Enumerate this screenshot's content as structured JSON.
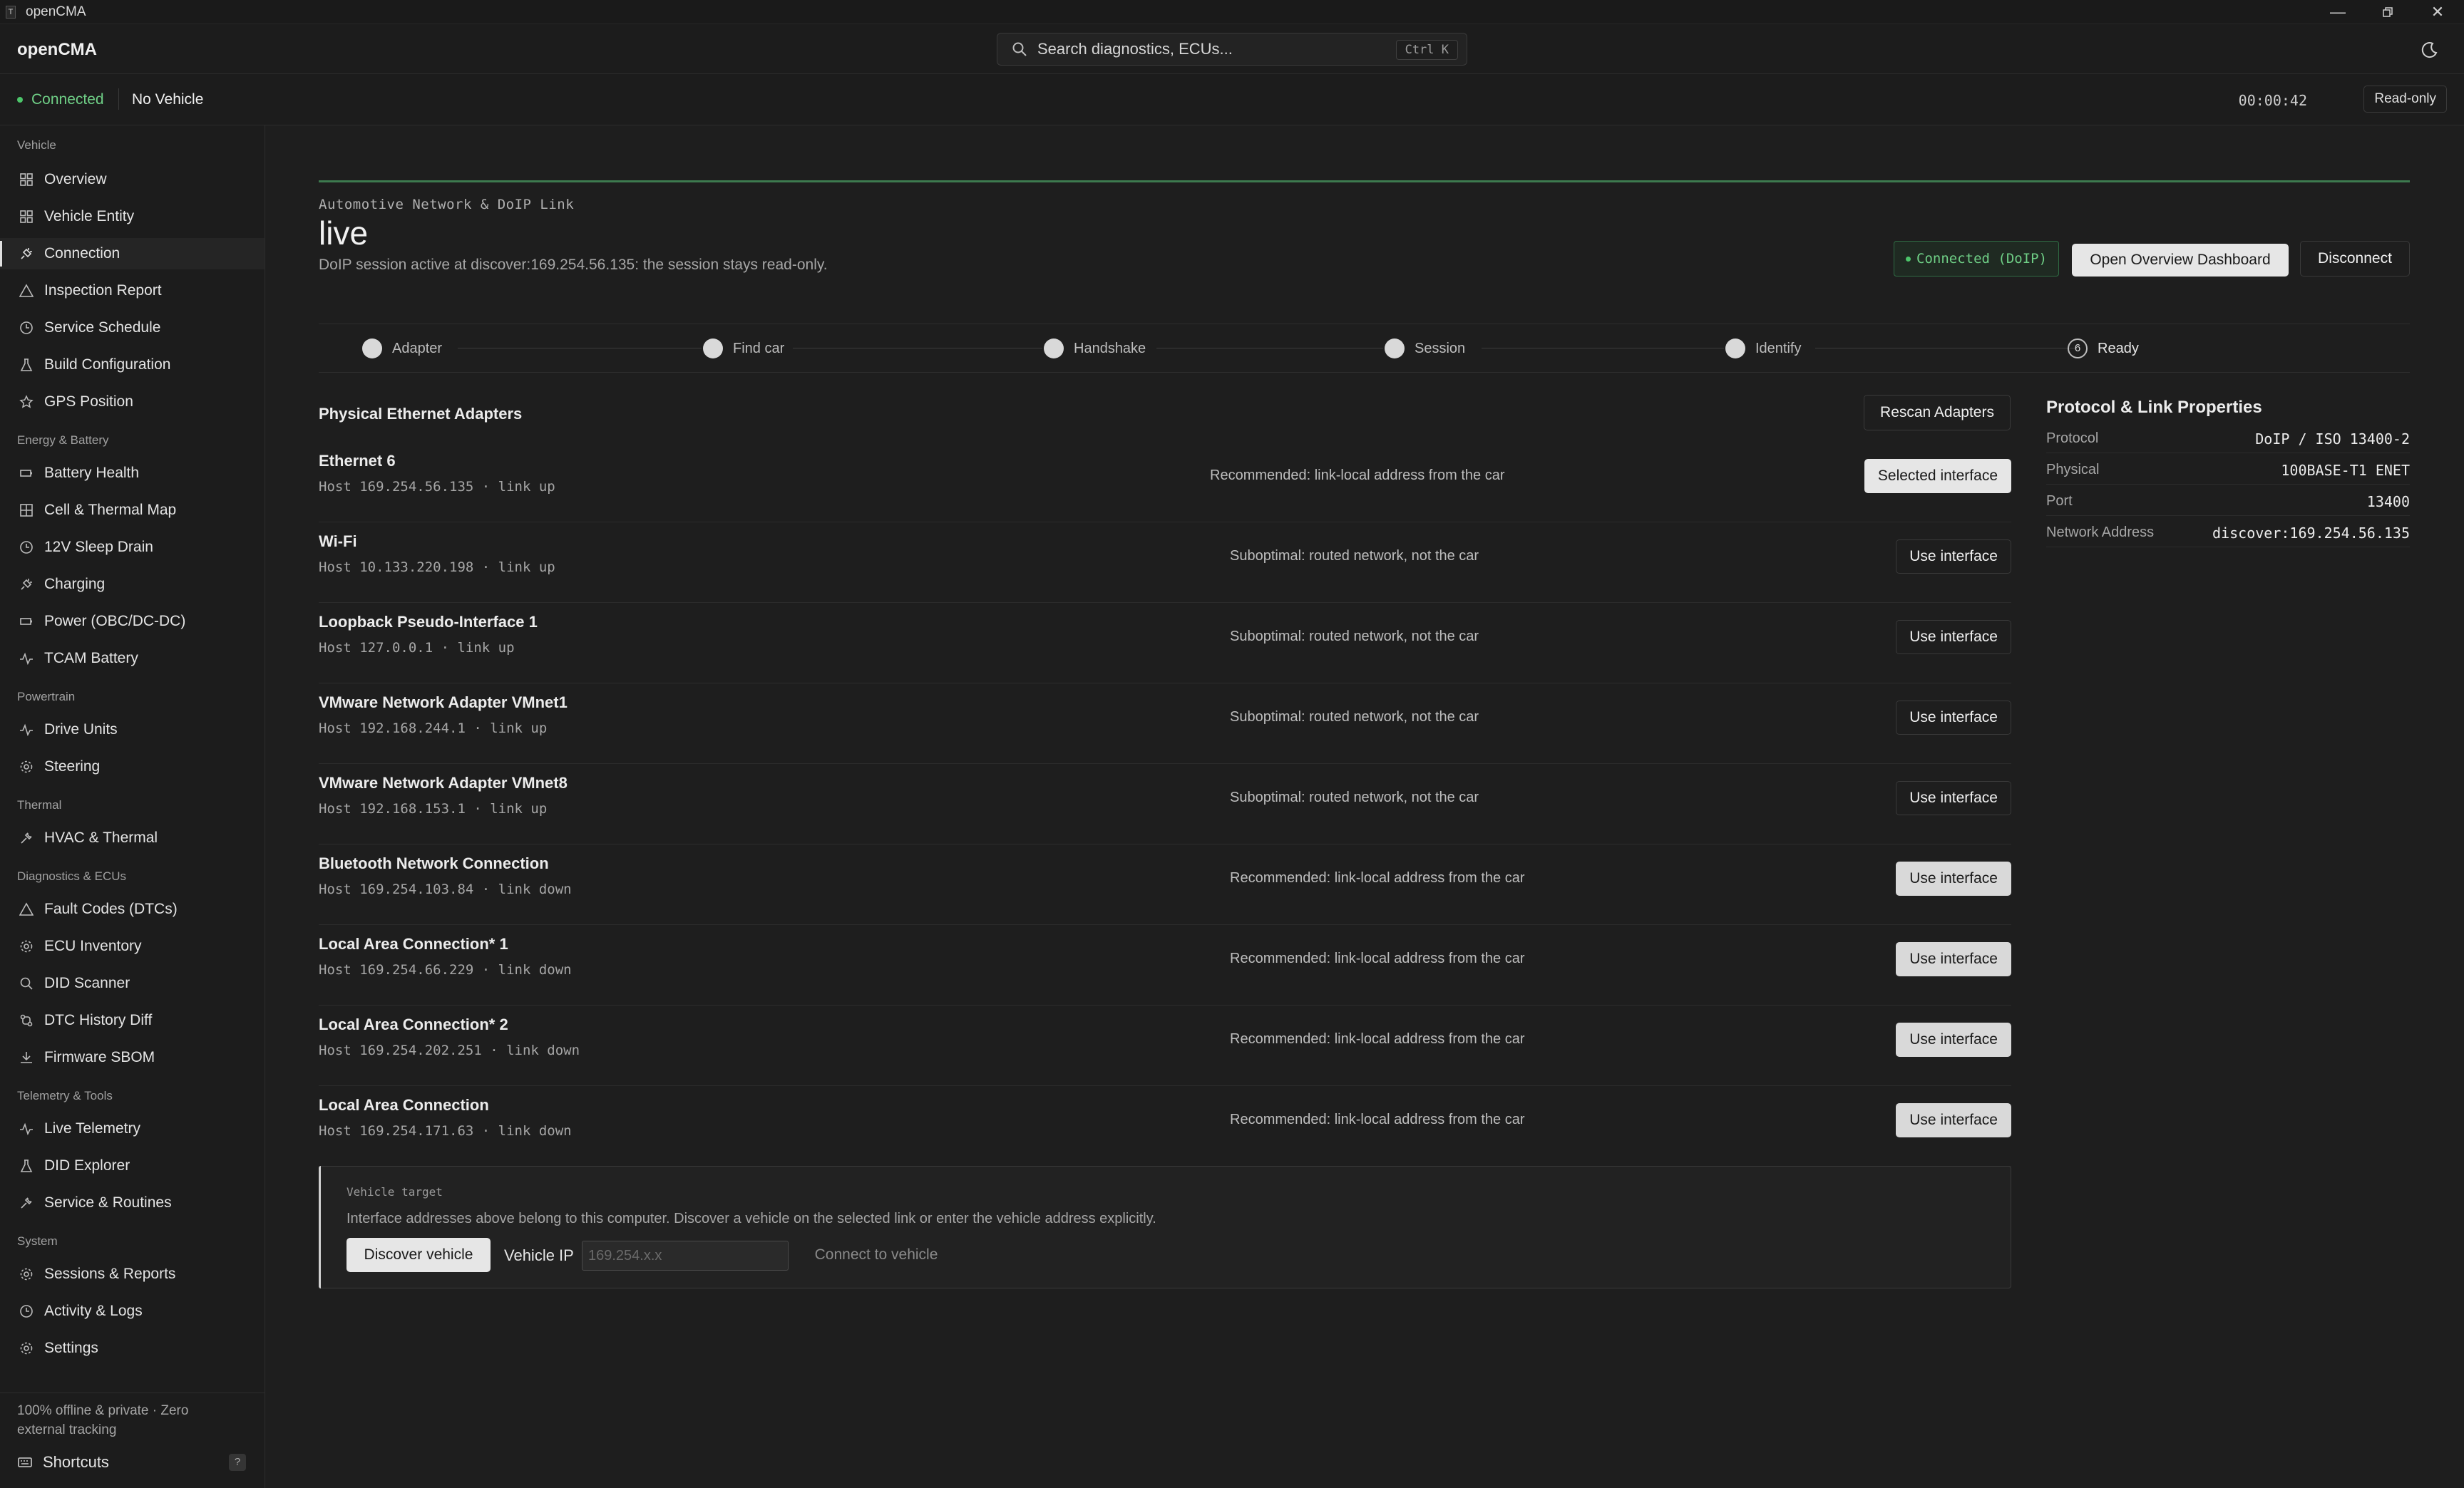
{
  "window": {
    "title": "openCMA",
    "icon_letter": "T"
  },
  "header": {
    "brand": "openCMA",
    "search_placeholder": "Search diagnostics, ECUs...",
    "search_shortcut": "Ctrl K"
  },
  "status": {
    "connection": "Connected",
    "vehicle": "No Vehicle",
    "timer": "00:00:42",
    "mode": "Read-only"
  },
  "sidebar": {
    "sections": [
      {
        "title": "Vehicle",
        "items": [
          {
            "label": "Overview",
            "icon": "grid-icon"
          },
          {
            "label": "Vehicle Entity",
            "icon": "grid-icon"
          },
          {
            "label": "Connection",
            "icon": "plug-icon",
            "active": true
          },
          {
            "label": "Inspection Report",
            "icon": "warning-icon"
          },
          {
            "label": "Service Schedule",
            "icon": "clock-icon"
          },
          {
            "label": "Build Configuration",
            "icon": "flask-icon"
          },
          {
            "label": "GPS Position",
            "icon": "star-icon"
          }
        ]
      },
      {
        "title": "Energy & Battery",
        "items": [
          {
            "label": "Battery Health",
            "icon": "battery-icon"
          },
          {
            "label": "Cell & Thermal Map",
            "icon": "grid-icon"
          },
          {
            "label": "12V Sleep Drain",
            "icon": "clock-icon"
          },
          {
            "label": "Charging",
            "icon": "plug-icon"
          },
          {
            "label": "Power (OBC/DC-DC)",
            "icon": "battery-icon"
          },
          {
            "label": "TCAM Battery",
            "icon": "pulse-icon"
          }
        ]
      },
      {
        "title": "Powertrain",
        "items": [
          {
            "label": "Drive Units",
            "icon": "pulse-icon"
          },
          {
            "label": "Steering",
            "icon": "gear-icon"
          }
        ]
      },
      {
        "title": "Thermal",
        "items": [
          {
            "label": "HVAC & Thermal",
            "icon": "wrench-icon"
          }
        ]
      },
      {
        "title": "Diagnostics & ECUs",
        "items": [
          {
            "label": "Fault Codes (DTCs)",
            "icon": "warning-icon"
          },
          {
            "label": "ECU Inventory",
            "icon": "gear-icon"
          },
          {
            "label": "DID Scanner",
            "icon": "search-icon"
          },
          {
            "label": "DTC History Diff",
            "icon": "diff-icon"
          },
          {
            "label": "Firmware SBOM",
            "icon": "download-icon"
          }
        ]
      },
      {
        "title": "Telemetry & Tools",
        "items": [
          {
            "label": "Live Telemetry",
            "icon": "pulse-icon"
          },
          {
            "label": "DID Explorer",
            "icon": "flask-icon"
          },
          {
            "label": "Service & Routines",
            "icon": "wrench-icon"
          }
        ]
      },
      {
        "title": "System",
        "items": [
          {
            "label": "Sessions & Reports",
            "icon": "gear-icon"
          },
          {
            "label": "Activity & Logs",
            "icon": "clock-icon"
          },
          {
            "label": "Settings",
            "icon": "gear-icon"
          }
        ]
      }
    ],
    "footer_note": "100% offline & private · Zero external tracking",
    "shortcuts_label": "Shortcuts",
    "shortcuts_key": "?"
  },
  "main": {
    "eyebrow": "Automotive Network & DoIP Link",
    "title": "live",
    "subtitle": "DoIP session active at discover:169.254.56.135: the session stays read-only.",
    "badge": "Connected (DoIP)",
    "open_dashboard": "Open Overview Dashboard",
    "disconnect": "Disconnect",
    "steps": [
      {
        "label": "Adapter"
      },
      {
        "label": "Find car"
      },
      {
        "label": "Handshake"
      },
      {
        "label": "Session"
      },
      {
        "label": "Identify"
      },
      {
        "label": "Ready",
        "number": "6"
      }
    ],
    "adapters_title": "Physical Ethernet Adapters",
    "rescan": "Rescan Adapters",
    "adapters": [
      {
        "name": "Ethernet 6",
        "host": "Host 169.254.56.135 · link up",
        "note": "Recommended: link-local address from the car",
        "button": "Selected interface",
        "style": "sel"
      },
      {
        "name": "Wi-Fi",
        "host": "Host 10.133.220.198 · link up",
        "note": "Suboptimal: routed network, not the car",
        "button": "Use interface",
        "style": "plain"
      },
      {
        "name": "Loopback Pseudo-Interface 1",
        "host": "Host 127.0.0.1 · link up",
        "note": "Suboptimal: routed network, not the car",
        "button": "Use interface",
        "style": "plain"
      },
      {
        "name": "VMware Network Adapter VMnet1",
        "host": "Host 192.168.244.1 · link up",
        "note": "Suboptimal: routed network, not the car",
        "button": "Use interface",
        "style": "plain"
      },
      {
        "name": "VMware Network Adapter VMnet8",
        "host": "Host 192.168.153.1 · link up",
        "note": "Suboptimal: routed network, not the car",
        "button": "Use interface",
        "style": "plain"
      },
      {
        "name": "Bluetooth Network Connection",
        "host": "Host 169.254.103.84 · link down",
        "note": "Recommended: link-local address from the car",
        "button": "Use interface",
        "style": "lightgray"
      },
      {
        "name": "Local Area Connection* 1",
        "host": "Host 169.254.66.229 · link down",
        "note": "Recommended: link-local address from the car",
        "button": "Use interface",
        "style": "lightgray"
      },
      {
        "name": "Local Area Connection* 2",
        "host": "Host 169.254.202.251 · link down",
        "note": "Recommended: link-local address from the car",
        "button": "Use interface",
        "style": "lightgray"
      },
      {
        "name": "Local Area Connection",
        "host": "Host 169.254.171.63 · link down",
        "note": "Recommended: link-local address from the car",
        "button": "Use interface",
        "style": "lightgray"
      }
    ],
    "vehicle_target": {
      "label": "Vehicle target",
      "description": "Interface addresses above belong to this computer. Discover a vehicle on the selected link or enter the vehicle address explicitly.",
      "discover": "Discover vehicle",
      "ip_label": "Vehicle IP",
      "ip_placeholder": "169.254.x.x",
      "connect": "Connect to vehicle"
    },
    "properties": {
      "title": "Protocol & Link Properties",
      "rows": [
        {
          "key": "Protocol",
          "value": "DoIP / ISO 13400-2"
        },
        {
          "key": "Physical",
          "value": "100BASE-T1 ENET"
        },
        {
          "key": "Port",
          "value": "13400"
        },
        {
          "key": "Network Address",
          "value": "discover:169.254.56.135"
        }
      ]
    }
  }
}
